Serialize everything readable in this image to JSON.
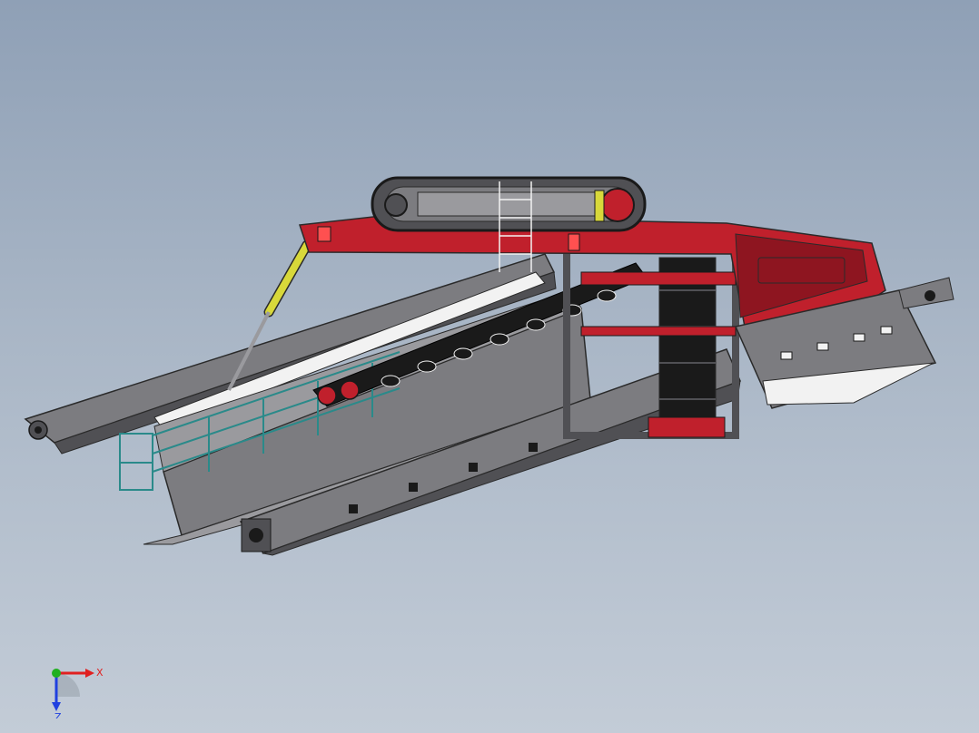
{
  "viewport": {
    "background_top": "#8fa0b6",
    "background_bottom": "#c3ccd7"
  },
  "model": {
    "colors": {
      "frame_red": "#c0202c",
      "frame_red_dark": "#8e1520",
      "steel_gray": "#7c7c80",
      "steel_gray_light": "#9a9a9e",
      "steel_gray_dark": "#505054",
      "belt_black": "#1a1a1a",
      "rail_teal": "#2a8a8a",
      "cylinder_yellow": "#d8d83a",
      "panel_white": "#f2f2f2",
      "outline": "#2a2a2a"
    }
  },
  "triad": {
    "x_label": "X",
    "z_label": "Z",
    "x_color": "#e02020",
    "y_color": "#20b020",
    "z_color": "#2040e0"
  }
}
